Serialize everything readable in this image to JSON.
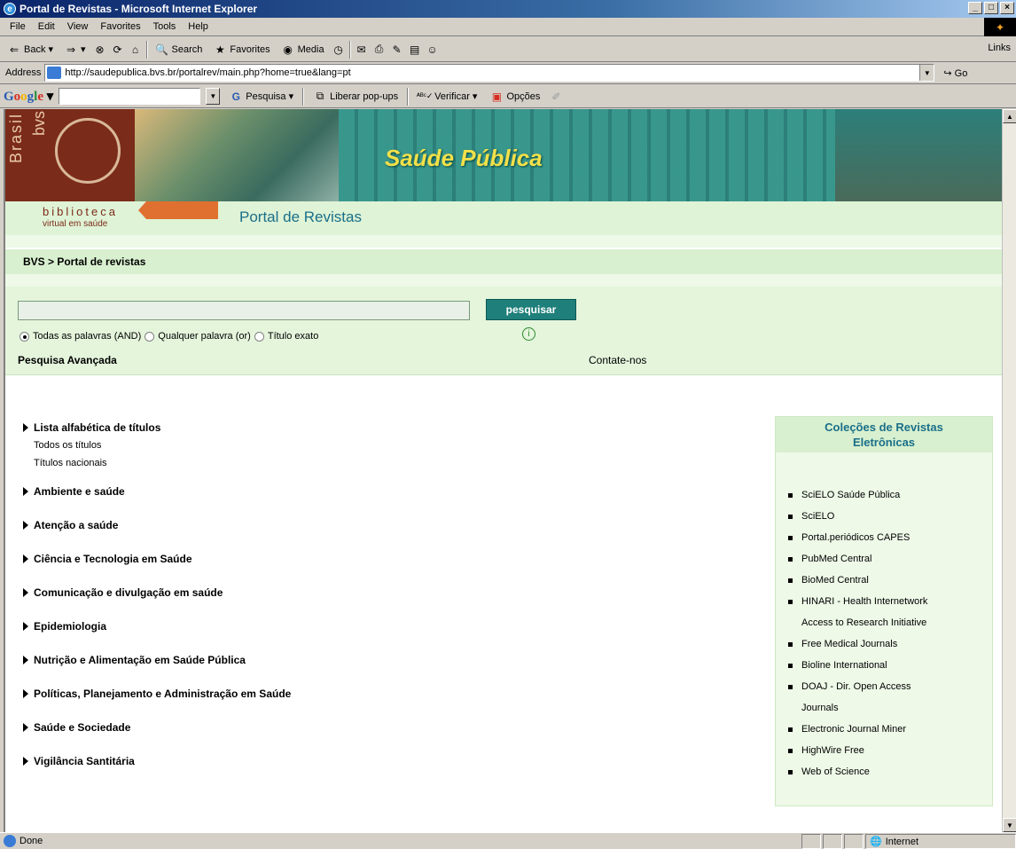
{
  "window": {
    "title": "Portal de Revistas - Microsoft Internet Explorer",
    "min": "_",
    "max": "□",
    "close": "×"
  },
  "menu": [
    "File",
    "Edit",
    "View",
    "Favorites",
    "Tools",
    "Help"
  ],
  "toolbar": {
    "back": "Back",
    "search": "Search",
    "favorites": "Favorites",
    "media": "Media",
    "links": "Links"
  },
  "address": {
    "label": "Address",
    "url": "http://saudepublica.bvs.br/portalrev/main.php?home=true&lang=pt",
    "go": "Go"
  },
  "googlebar": {
    "pesquisa": "Pesquisa",
    "popups": "Liberar pop-ups",
    "verificar": "Verificar",
    "opcoes": "Opções"
  },
  "banner": {
    "title": "Saúde Pública",
    "brasil": "Brasil",
    "bvs": "bvs",
    "biblioteca": "biblioteca",
    "virtual": "virtual em saúde",
    "portal_title": "Portal de Revistas"
  },
  "breadcrumb": "BVS > Portal de revistas",
  "search": {
    "button": "pesquisar",
    "opt_and": "Todas as palavras (AND)",
    "opt_or": "Qualquer palavra (or)",
    "opt_exact": "Título exato",
    "advanced": "Pesquisa Avançada",
    "contact": "Contate-nos"
  },
  "categories": {
    "alpha": "Lista alfabética de títulos",
    "all": "Todos os títulos",
    "national": "Títulos nacionais",
    "items": [
      "Ambiente e saúde",
      "Atenção a saúde",
      "Ciência e Tecnologia em Saúde",
      "Comunicação e divulgação em saúde",
      "Epidemiologia",
      "Nutrição e Alimentação em Saúde Pública",
      "Políticas, Planejamento e Administração em Saúde",
      "Saúde e Sociedade",
      "Vigilância Santitária"
    ]
  },
  "collections": {
    "title1": "Coleções de Revistas",
    "title2": "Eletrônicas",
    "items": [
      "SciELO Saúde Pública",
      "SciELO",
      "Portal.periódicos CAPES",
      "PubMed Central",
      "BioMed Central",
      "HINARI - Health Internetwork",
      "Access to Research Initiative",
      "Free Medical Journals",
      "Bioline International",
      "DOAJ - Dir. Open Access",
      "Journals",
      "Electronic Journal Miner",
      "HighWire Free",
      "Web of Science"
    ]
  },
  "status": {
    "text": "Done",
    "zone": "Internet"
  }
}
